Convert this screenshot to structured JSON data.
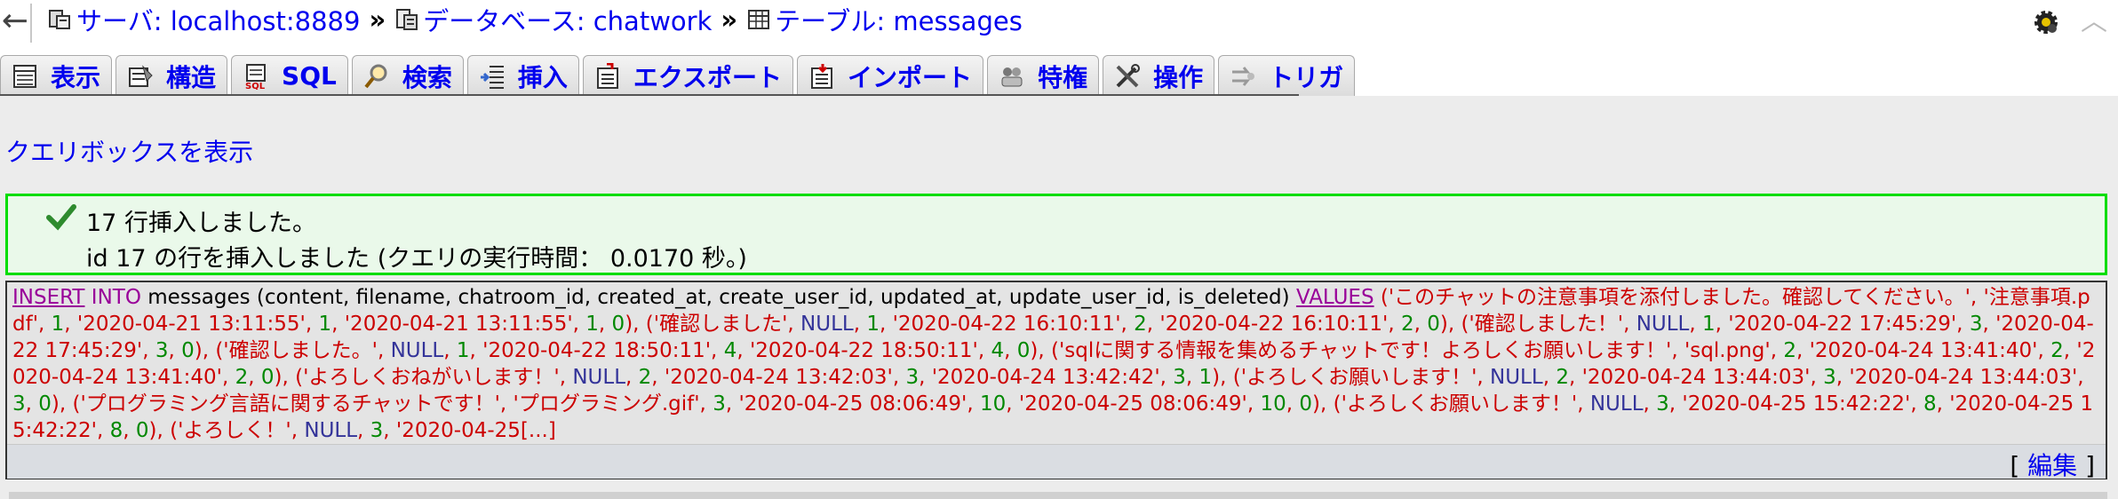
{
  "breadcrumb": {
    "server": "サーバ: localhost:8889",
    "database": "データベース: chatwork",
    "table": "テーブル: messages",
    "separator": "»"
  },
  "tabs": [
    {
      "label": "表示",
      "icon": "browse-icon"
    },
    {
      "label": "構造",
      "icon": "structure-icon"
    },
    {
      "label": "SQL",
      "icon": "sql-icon"
    },
    {
      "label": "検索",
      "icon": "search-icon"
    },
    {
      "label": "挿入",
      "icon": "insert-icon"
    },
    {
      "label": "エクスポート",
      "icon": "export-icon"
    },
    {
      "label": "インポート",
      "icon": "import-icon"
    },
    {
      "label": "特権",
      "icon": "privileges-icon"
    },
    {
      "label": "操作",
      "icon": "operations-icon"
    },
    {
      "label": "トリガ",
      "icon": "triggers-icon"
    }
  ],
  "query_box_link": "クエリボックスを表示",
  "success": {
    "line1": "17 行挿入しました。",
    "line2": "id 17 の行を挿入しました (クエリの実行時間： 0.0170 秒。)"
  },
  "sql": {
    "insert": "INSERT",
    "into": "INTO",
    "table_and_cols": " messages (content, filename, chatroom_id, created_at, create_user_id, updated_at, update_user_id, is_deleted) ",
    "values": "VALUES",
    "tail": "[...]"
  },
  "edit": {
    "open": "[ ",
    "label": "編集",
    "close": " ]"
  },
  "colors": {
    "link": "#0000ee",
    "success_border": "#00dd00",
    "string": "#cc0000",
    "number": "#008800",
    "keyword": "#990099"
  }
}
